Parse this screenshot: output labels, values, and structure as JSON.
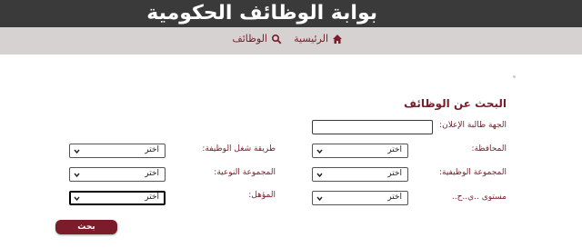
{
  "header": {
    "title": "بوابة الوظائف الحكومية"
  },
  "nav": {
    "home_label": "الرئيسية",
    "jobs_label": "الوظائف"
  },
  "form": {
    "title": "البحث عن الوظائف",
    "fields": {
      "advertiser": {
        "label": "الجهة طالبة الإعلان:",
        "value": ""
      },
      "governorate": {
        "label": "المحافظة:",
        "value": "اختر"
      },
      "job_group": {
        "label": "المجموعة الوظيفية:",
        "value": "اختر"
      },
      "level": {
        "label": "مستوى ..ي..ح..",
        "value": "اختر"
      },
      "employment_type": {
        "label": "طريقة شغل الوظيفة:",
        "value": "اختر"
      },
      "qualitative_group": {
        "label": "المجموعة النوعية:",
        "value": "اختر"
      },
      "qualification": {
        "label": "المؤهل:",
        "value": "اختر"
      }
    },
    "search_label": "بحث"
  },
  "colors": {
    "brand": "#7a1c2a",
    "header_bg": "#3a3a3a",
    "nav_bg": "#d6d2d2"
  }
}
